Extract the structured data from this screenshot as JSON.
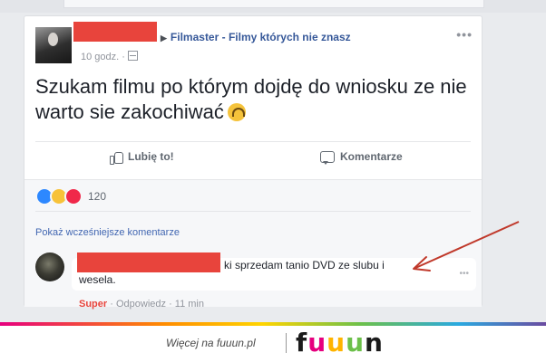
{
  "post": {
    "author_redacted": true,
    "group_name": "Filmaster - Filmy których nie znasz",
    "time": "10 godz. ·",
    "more_label": "•••",
    "text": "Szukam filmu po którym dojdę do wniosku ze nie warto sie zakochiwać",
    "emoji_icon": "upside-down-face-emoji",
    "actions": {
      "like_label": "Lubię to!",
      "comment_label": "Komentarze"
    }
  },
  "reactions": {
    "icons": [
      "like-reaction-icon",
      "haha-reaction-icon",
      "love-reaction-icon"
    ],
    "count": "120"
  },
  "comments": {
    "show_previous": "Pokaż wcześniejsze komentarze",
    "items": [
      {
        "author_redacted": true,
        "text_tail": "ki sprzedam tanio DVD ze slubu i",
        "text_line2": "wesela.",
        "super_label": "Super",
        "reply_label": "· Odpowiedz",
        "time": "· 11 min"
      }
    ]
  },
  "annotation": {
    "arrow_color": "#c0392b"
  },
  "footer": {
    "link_text": "Więcej na fuuun.pl",
    "logo_letters": [
      "f",
      "u",
      "u",
      "u",
      "n"
    ],
    "logo_colors": [
      "#1b1b1b",
      "#e6007e",
      "#ffb400",
      "#6cc04a",
      "#1b1b1b"
    ]
  }
}
